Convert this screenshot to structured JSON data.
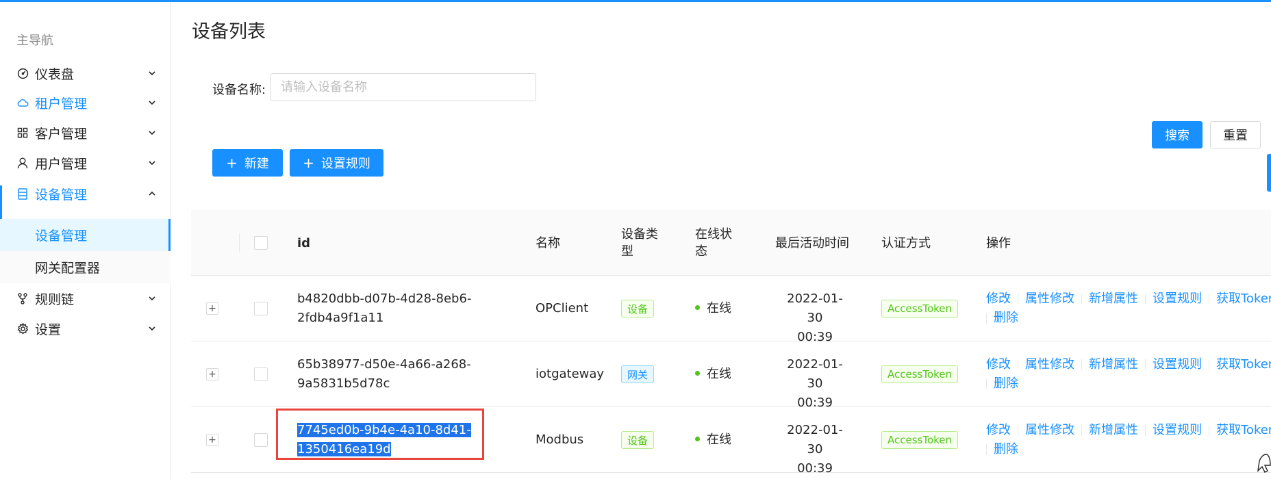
{
  "sidebar": {
    "title": "主导航",
    "items": [
      {
        "label": "仪表盘",
        "icon": "dashboard-icon"
      },
      {
        "label": "租户管理",
        "icon": "cloud-icon"
      },
      {
        "label": "客户管理",
        "icon": "appstore-icon"
      },
      {
        "label": "用户管理",
        "icon": "user-icon"
      },
      {
        "label": "设备管理",
        "icon": "database-icon"
      },
      {
        "label": "规则链",
        "icon": "fork-icon"
      },
      {
        "label": "设置",
        "icon": "gear-icon"
      }
    ],
    "sub_items": [
      {
        "label": "设备管理"
      },
      {
        "label": "网关配置器"
      }
    ]
  },
  "page": {
    "title": "设备列表",
    "search_label": "设备名称:",
    "search_placeholder": "请输入设备名称",
    "search_value": "",
    "search_button": "搜索",
    "reset_button": "重置",
    "new_button": "新建",
    "rule_button": "设置规则"
  },
  "table": {
    "headers": {
      "id": "id",
      "name": "名称",
      "type_line1": "设备类",
      "type_line2": "型",
      "status_line1": "在线状",
      "status_line2": "态",
      "last_active": "最后活动时间",
      "auth": "认证方式",
      "ops": "操作"
    },
    "rows": [
      {
        "id_line1": "b4820dbb-d07b-4d28-8eb6-",
        "id_line2": "2fdb4a9f1a11",
        "name": "OPClient",
        "type": "设备",
        "status": "在线",
        "date": "2022-01-30",
        "time": "00:39",
        "auth": "AccessToken"
      },
      {
        "id_line1": "65b38977-d50e-4a66-a268-",
        "id_line2": "9a5831b5d78c",
        "name": "iotgateway",
        "type": "网关",
        "status": "在线",
        "date": "2022-01-30",
        "time": "00:39",
        "auth": "AccessToken"
      },
      {
        "id_line1": "7745ed0b-9b4e-4a10-8d41-",
        "id_line2": "1350416ea19d",
        "name": "Modbus",
        "type": "设备",
        "status": "在线",
        "date": "2022-01-30",
        "time": "00:39",
        "auth": "AccessToken"
      }
    ],
    "actions": {
      "edit": "修改",
      "edit_attr": "属性修改",
      "add_attr": "新增属性",
      "set_rule": "设置规则",
      "get_token": "获取Token",
      "delete": "删除"
    }
  },
  "colors": {
    "primary": "#1890ff",
    "success": "#52c41a",
    "highlight": "#e8453c"
  }
}
